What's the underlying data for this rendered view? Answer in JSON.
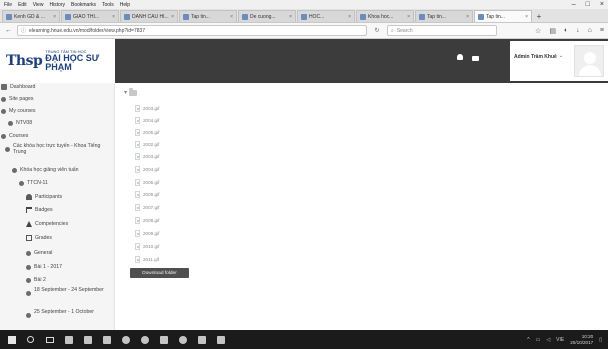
{
  "browser": {
    "menu": [
      "File",
      "Edit",
      "View",
      "History",
      "Bookmarks",
      "Tools",
      "Help"
    ],
    "tabs": [
      {
        "label": "Kenh GD & ..."
      },
      {
        "label": "GIAO THI..."
      },
      {
        "label": "DANH CAU HI..."
      },
      {
        "label": "Tap tin..."
      },
      {
        "label": "De cuong..."
      },
      {
        "label": "HOC..."
      },
      {
        "label": "Khoa hoc..."
      },
      {
        "label": "Tap tin..."
      },
      {
        "label": "Tap tin..."
      }
    ],
    "url": "elearning.hnue.edu.vn/mod/folder/view.php?id=7837",
    "search_placeholder": "Search",
    "window_controls": [
      "–",
      "□",
      "×"
    ]
  },
  "header": {
    "logo_mark": "Thsp",
    "logo_top": "TRUNG TÂM TIN HỌC",
    "logo_bottom": "ĐẠI HỌC SƯ PHẠM",
    "user_name": "Admin Trâm Khuê",
    "user_caret": "⌄"
  },
  "sidebar": {
    "items": [
      {
        "label": "Dashboard",
        "indent": 0,
        "icon": "dashboard-icon"
      },
      {
        "label": "Site pages",
        "indent": 0,
        "icon": "bullet-icon"
      },
      {
        "label": "My courses",
        "indent": 0,
        "icon": "bullet-icon"
      },
      {
        "label": "NTV08",
        "indent": 1,
        "icon": "bullet-icon"
      },
      {
        "label": "Courses",
        "indent": 0,
        "icon": "bullet-icon"
      },
      {
        "label": "Các khóa học trực tuyến - Khoa Tiếng Trung",
        "indent": 1,
        "icon": "bullet-icon"
      },
      {
        "label": "Khóa học giảng viên tuấn",
        "indent": 2,
        "icon": "bullet-icon"
      },
      {
        "label": "TTCN-11",
        "indent": 3,
        "icon": "bullet-icon"
      },
      {
        "label": "Participants",
        "indent": 4,
        "icon": "people-icon"
      },
      {
        "label": "Badges",
        "indent": 4,
        "icon": "flag-icon"
      },
      {
        "label": "Competencies",
        "indent": 4,
        "icon": "triangle-icon"
      },
      {
        "label": "Grades",
        "indent": 4,
        "icon": "grade-icon"
      },
      {
        "label": "General",
        "indent": 4,
        "icon": "bullet-icon"
      },
      {
        "label": "Bài 1 - 2017",
        "indent": 4,
        "icon": "bullet-icon"
      },
      {
        "label": "Bài 2",
        "indent": 4,
        "icon": "bullet-icon"
      },
      {
        "label": "18 September - 24 September",
        "indent": 4,
        "icon": "bullet-icon"
      },
      {
        "label": "25 September - 1 October",
        "indent": 4,
        "icon": "bullet-icon"
      }
    ]
  },
  "content": {
    "files": [
      "2003.gif",
      "2004.gif",
      "2005.gif",
      "2002.gif",
      "2003.gif",
      "2004.gif",
      "2005.gif",
      "2006.gif",
      "2007.gif",
      "2008.gif",
      "2009.gif",
      "2010.gif",
      "2011.gif"
    ],
    "download_label": "Download folder"
  },
  "taskbar": {
    "tray_text": "VIE",
    "time": "10:20",
    "date": "20/10/2017"
  }
}
